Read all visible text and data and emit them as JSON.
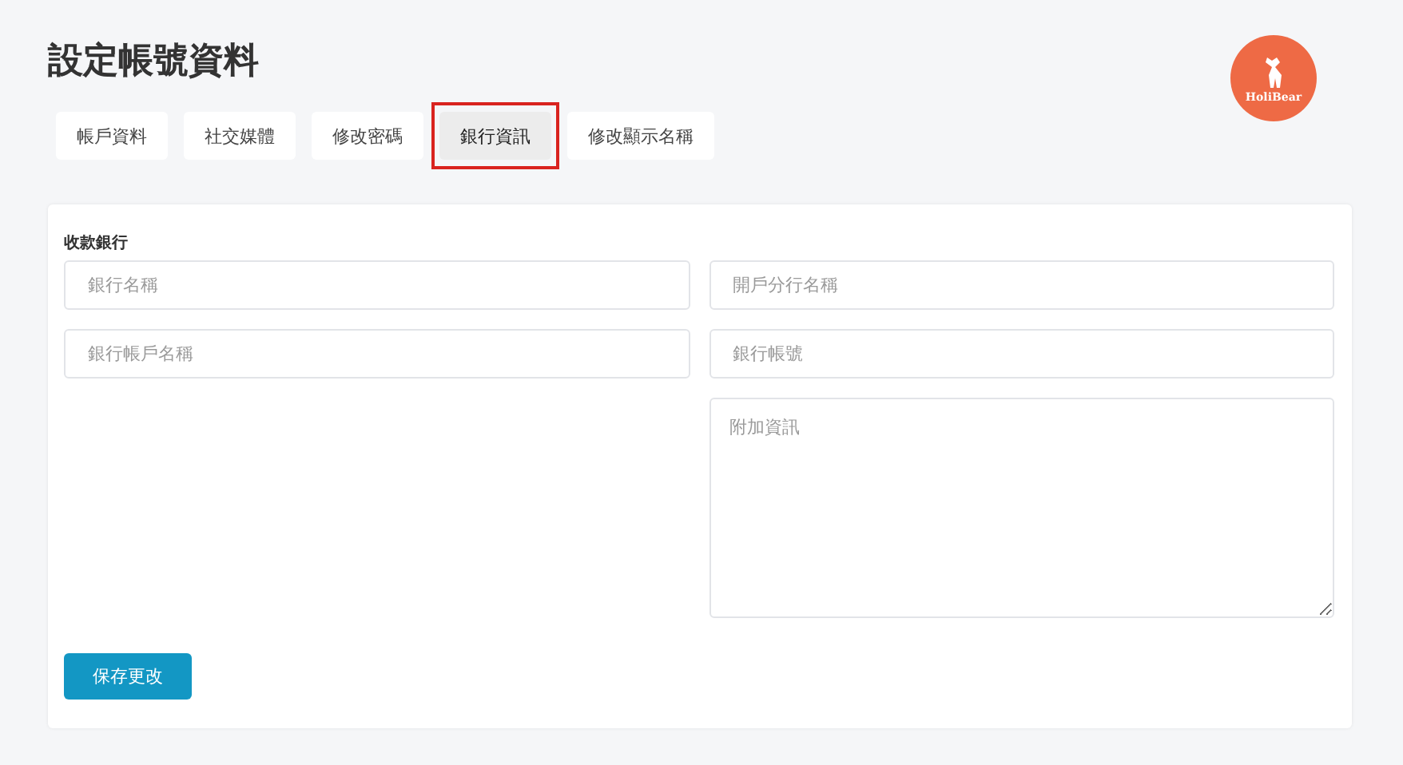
{
  "page": {
    "title": "設定帳號資料"
  },
  "logo": {
    "text": "HoliBear"
  },
  "tabs": [
    {
      "label": "帳戶資料",
      "selected": false,
      "highlighted": false
    },
    {
      "label": "社交媒體",
      "selected": false,
      "highlighted": false
    },
    {
      "label": "修改密碼",
      "selected": false,
      "highlighted": false
    },
    {
      "label": "銀行資訊",
      "selected": true,
      "highlighted": true
    },
    {
      "label": "修改顯示名稱",
      "selected": false,
      "highlighted": false
    }
  ],
  "form": {
    "section_label": "收款銀行",
    "fields": [
      {
        "kind": "input",
        "placeholder": "銀行名稱"
      },
      {
        "kind": "input",
        "placeholder": "開戶分行名稱"
      },
      {
        "kind": "input",
        "placeholder": "銀行帳戶名稱"
      },
      {
        "kind": "input",
        "placeholder": "銀行帳號"
      },
      {
        "kind": "textarea",
        "placeholder": "附加資訊"
      }
    ],
    "submit": "保存更改"
  }
}
